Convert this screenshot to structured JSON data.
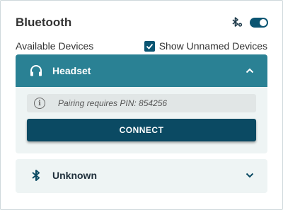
{
  "header": {
    "title": "Bluetooth",
    "settings_icon": "bluetooth-settings-icon",
    "toggle_on": true
  },
  "subheader": {
    "available_label": "Available Devices",
    "show_unnamed_label": "Show Unnamed Devices",
    "show_unnamed_checked": true
  },
  "devices": [
    {
      "name": "Headset",
      "icon": "headphones-icon",
      "expanded": true,
      "info_text": "Pairing requires PIN: 854256",
      "connect_label": "CONNECT"
    },
    {
      "name": "Unknown",
      "icon": "bluetooth-icon",
      "expanded": false
    }
  ],
  "colors": {
    "accent": "#0b5572",
    "header_expanded": "#2a8194",
    "card_bg": "#eef4f4",
    "button": "#0b4a63"
  }
}
